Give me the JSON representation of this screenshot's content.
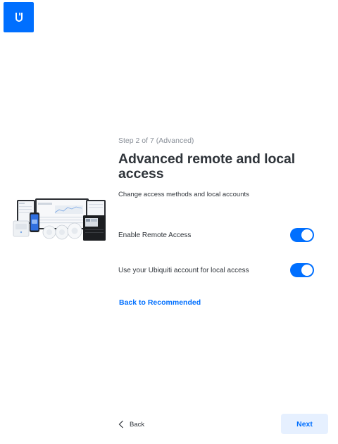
{
  "brand": {
    "logo_icon": "ubiquiti-u-logo",
    "accent_color": "#006fff"
  },
  "wizard": {
    "step_text": "Step 2 of 7 (Advanced)",
    "title": "Advanced remote and local access",
    "subtitle": "Change access methods and local accounts"
  },
  "options": [
    {
      "label": "Enable Remote Access",
      "enabled": true
    },
    {
      "label": "Use your Ubiquiti account for local access",
      "enabled": true
    }
  ],
  "links": {
    "back_to_recommended": "Back to Recommended"
  },
  "footer": {
    "back_label": "Back",
    "next_label": "Next"
  }
}
